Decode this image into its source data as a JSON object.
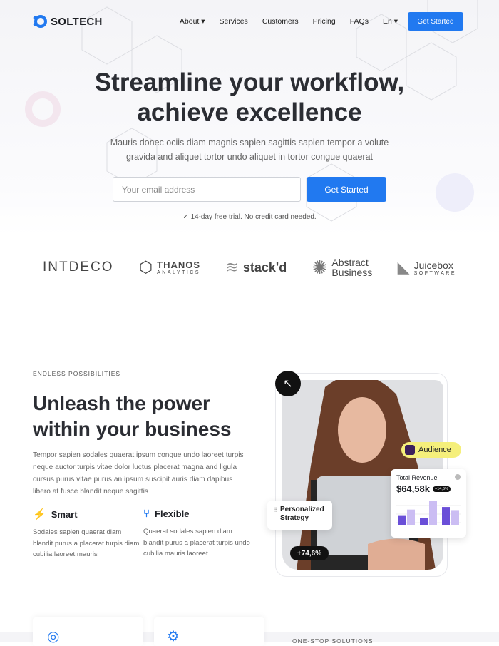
{
  "brand": {
    "name": "SOLTECH",
    "accent": "#2179f0"
  },
  "nav": {
    "items": [
      "About",
      "Services",
      "Customers",
      "Pricing",
      "FAQs",
      "En"
    ],
    "cta": "Get Started"
  },
  "hero": {
    "title_line1": "Streamline your workflow,",
    "title_line2": "achieve excellence",
    "subtitle": "Mauris donec ociis diam magnis sapien sagittis sapien tempor a volute gravida and aliquet tortor undo aliquet in tortor congue quaerat",
    "email_placeholder": "Your email address",
    "cta": "Get Started",
    "trial_note": "14-day free trial. No credit card needed."
  },
  "logos": [
    {
      "name": "INTDECO"
    },
    {
      "name": "THANOS",
      "sub": "ANALYTICS"
    },
    {
      "name": "stack'd"
    },
    {
      "name": "Abstract",
      "sub": "Business"
    },
    {
      "name": "Juicebox",
      "sub": "SOFTWARE"
    }
  ],
  "section": {
    "eyebrow": "ENDLESS POSSIBILITIES",
    "title_line1": "Unleash the power",
    "title_line2": "within your business",
    "body": "Tempor sapien sodales quaerat ipsum congue undo laoreet turpis neque auctor turpis vitae dolor luctus placerat magna and ligula cursus purus vitae purus an ipsum suscipit auris diam dapibus libero at fusce blandit neque sagittis",
    "features": [
      {
        "icon": "lightbulb-icon",
        "title": "Smart",
        "body": "Sodales sapien quaerat diam blandit purus a placerat turpis diam cubilia laoreet mauris"
      },
      {
        "icon": "git-flow-icon",
        "title": "Flexible",
        "body": "Quaerat sodales sapien diam blandit purus a placerat turpis undo cubilia mauris laoreet"
      }
    ]
  },
  "visual": {
    "audience": "Audience",
    "revenue_label": "Total Revenue",
    "revenue_value": "$64,58k",
    "revenue_badge": "+14,6%",
    "strategy": "Personalized Strategy",
    "growth": "+74,6%",
    "bars": [
      [
        0.4,
        0.62
      ],
      [
        0.3,
        0.95
      ],
      [
        0.72,
        0.6
      ]
    ]
  },
  "next": {
    "eyebrow": "ONE-STOP SOLUTIONS"
  }
}
